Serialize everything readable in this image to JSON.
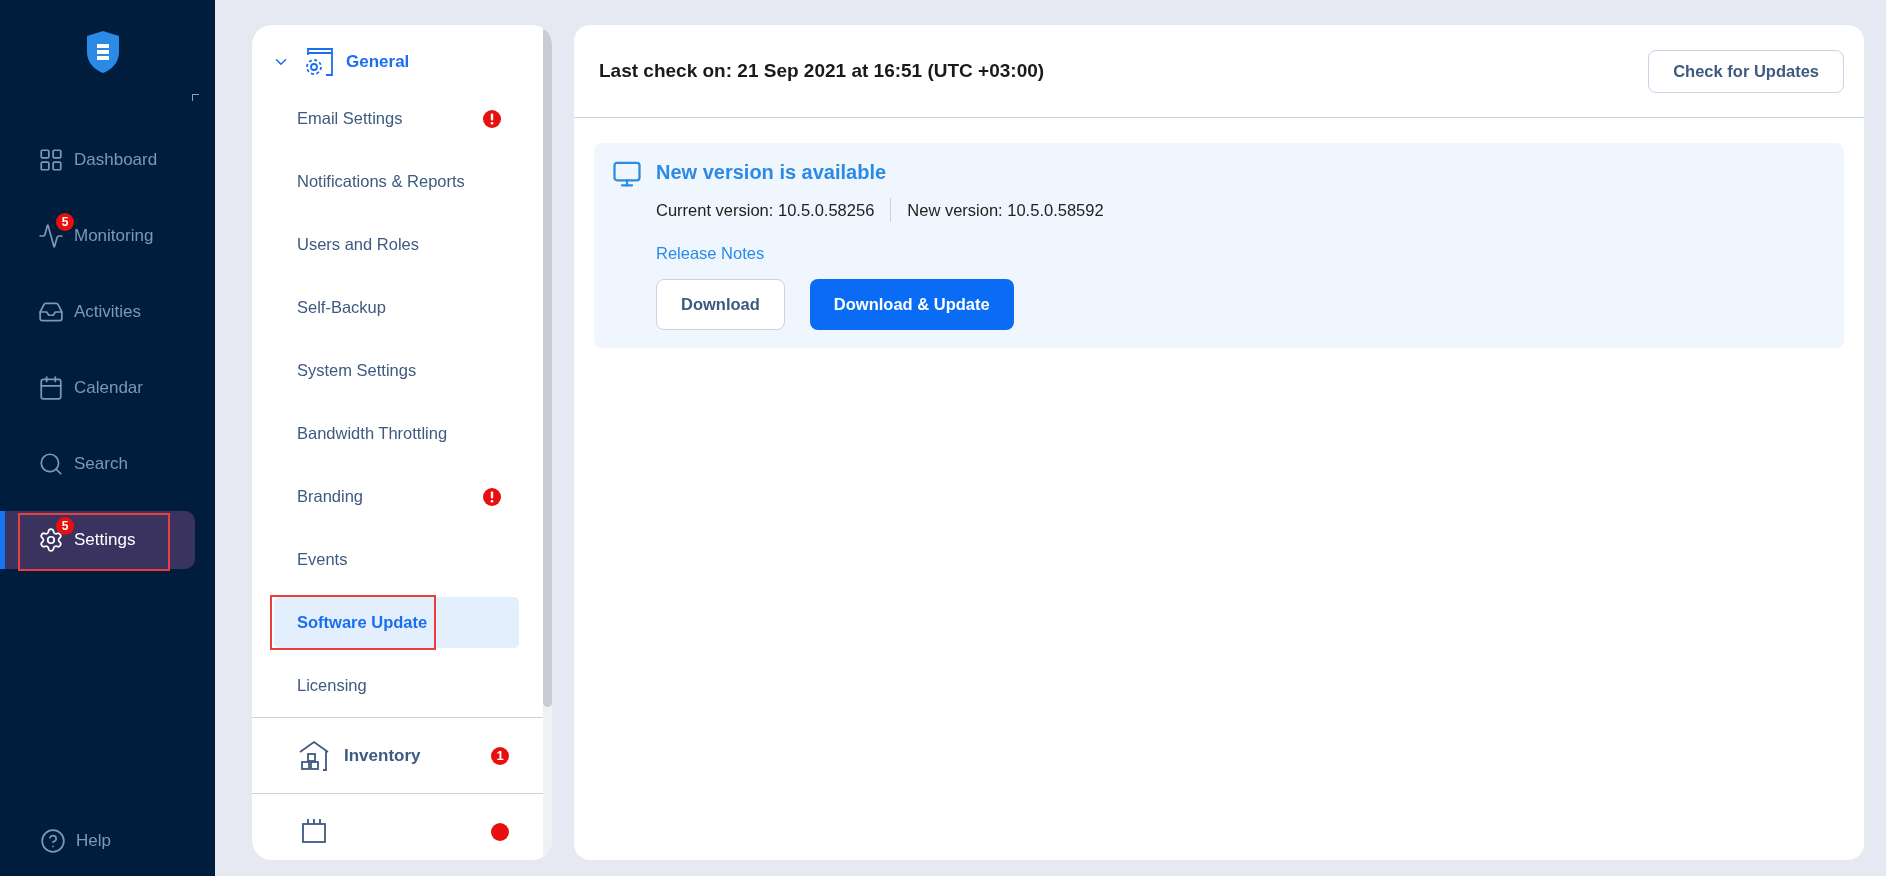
{
  "nav": {
    "items": [
      {
        "kind": "dashboard",
        "label": "Dashboard",
        "selected": false,
        "highlighted": false
      },
      {
        "kind": "monitoring",
        "label": "Monitoring",
        "badge": "5",
        "selected": false,
        "highlighted": false
      },
      {
        "kind": "activities",
        "label": "Activities",
        "selected": false,
        "highlighted": false
      },
      {
        "kind": "calendar",
        "label": "Calendar",
        "selected": false,
        "highlighted": false
      },
      {
        "kind": "search",
        "label": "Search",
        "selected": false,
        "highlighted": false
      },
      {
        "kind": "settings",
        "label": "Settings",
        "badge": "5",
        "selected": true,
        "highlighted": true
      }
    ],
    "help": "Help"
  },
  "settings_menu": {
    "sections": [
      {
        "kind": "general",
        "label": "General",
        "expanded": true,
        "items": [
          {
            "label": "Email Settings",
            "alert": true,
            "selected": false,
            "highlighted": false
          },
          {
            "label": "Notifications & Reports",
            "alert": false,
            "selected": false,
            "highlighted": false
          },
          {
            "label": "Users and Roles",
            "alert": false,
            "selected": false,
            "highlighted": false
          },
          {
            "label": "Self-Backup",
            "alert": false,
            "selected": false,
            "highlighted": false
          },
          {
            "label": "System Settings",
            "alert": false,
            "selected": false,
            "highlighted": false
          },
          {
            "label": "Bandwidth Throttling",
            "alert": false,
            "selected": false,
            "highlighted": false
          },
          {
            "label": "Branding",
            "alert": true,
            "selected": false,
            "highlighted": false
          },
          {
            "label": "Events",
            "alert": false,
            "selected": false,
            "highlighted": false
          },
          {
            "label": "Software Update",
            "alert": false,
            "selected": true,
            "highlighted": true
          },
          {
            "label": "Licensing",
            "alert": false,
            "selected": false,
            "highlighted": false
          }
        ]
      },
      {
        "kind": "inventory",
        "label": "Inventory",
        "badge": "1",
        "expanded": false
      },
      {
        "kind": "transporters",
        "expanded": false
      }
    ]
  },
  "update": {
    "last_check": "Last check on: 21 Sep 2021 at 16:51 (UTC +03:00)",
    "check_button": "Check for Updates",
    "notice": {
      "title": "New version is available",
      "current": "Current version: 10.5.0.58256",
      "new": "New version: 10.5.0.58592",
      "link": "Release Notes",
      "buttons": [
        {
          "label": "Download",
          "kind": "secondary"
        },
        {
          "label": "Download & Update",
          "kind": "primary"
        }
      ]
    }
  }
}
